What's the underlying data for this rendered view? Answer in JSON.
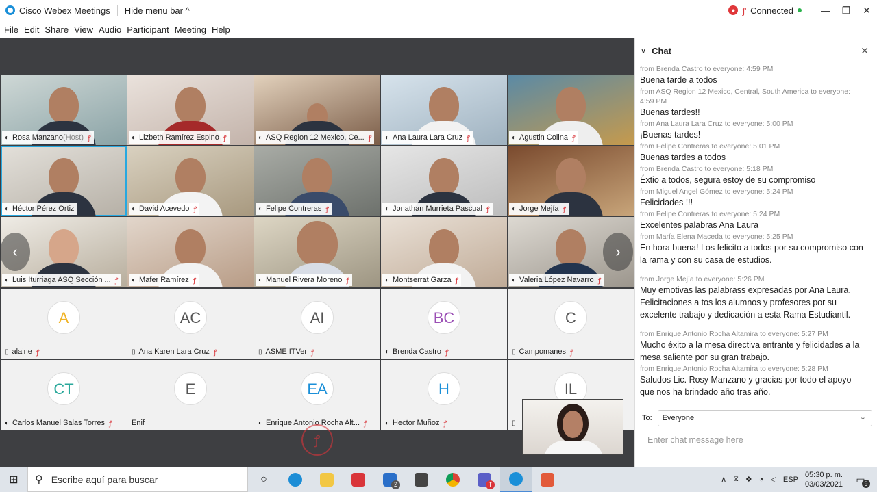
{
  "window": {
    "title": "Cisco Webex Meetings",
    "hide_menu": "Hide menu bar ^",
    "status": "Connected",
    "min": "—",
    "restore": "❐",
    "close": "✕"
  },
  "menu": [
    "File",
    "Edit",
    "Share",
    "View",
    "Audio",
    "Participant",
    "Meeting",
    "Help"
  ],
  "tiles": {
    "t1": {
      "name": "Rosa Manzano",
      "suffix": " (Host)"
    },
    "t2": {
      "name": "Lizbeth Ramírez Espino"
    },
    "t3": {
      "name": "ASQ Region 12 Mexico, Ce..."
    },
    "t4": {
      "name": "Ana Laura Lara Cruz"
    },
    "t5": {
      "name": "Agustin Colina"
    },
    "t6": {
      "name": "Héctor Pérez Ortiz"
    },
    "t7": {
      "name": "David Acevedo"
    },
    "t8": {
      "name": "Felipe Contreras"
    },
    "t9": {
      "name": "Jonathan Murrieta Pascual"
    },
    "t10": {
      "name": "Jorge Mejía"
    },
    "t11": {
      "name": "Luis Iturriaga ASQ Sección ..."
    },
    "t12": {
      "name": "Mafer Ramírez"
    },
    "t13": {
      "name": "Manuel Rivera Moreno"
    },
    "t14": {
      "name": "Montserrat Garza"
    },
    "t15": {
      "name": "Valeria López Navarro"
    },
    "a1": {
      "initials": "A",
      "name": "alaine"
    },
    "a2": {
      "initials": "AC",
      "name": "Ana Karen Lara Cruz"
    },
    "a3": {
      "initials": "AI",
      "name": "ASME ITVer"
    },
    "a4": {
      "initials": "BC",
      "name": "Brenda Castro"
    },
    "a5": {
      "initials": "C",
      "name": "Campomanes"
    },
    "a6": {
      "initials": "CT",
      "name": "Carlos Manuel Salas Torres"
    },
    "a7": {
      "initials": "E",
      "name": "Enif"
    },
    "a8": {
      "initials": "EA",
      "name": "Enrique Antonio Rocha Alt..."
    },
    "a9": {
      "initials": "H",
      "name": "Hector Muñoz"
    },
    "a10": {
      "initials": "IL",
      "name": ""
    }
  },
  "chat": {
    "title": "Chat",
    "messages": [
      {
        "meta": "from Brenda Castro to everyone:    4:59 PM",
        "text": "Buena tarde a todos"
      },
      {
        "meta": "from ASQ Region 12 Mexico, Central, South America to everyone: 4:59 PM",
        "text": "Buenas tardes!!"
      },
      {
        "meta": "from Ana Laura Lara Cruz to everyone:    5:00 PM",
        "text": "¡Buenas tardes!"
      },
      {
        "meta": "from Felipe Contreras to everyone:    5:01 PM",
        "text": "Buenas tardes a todos"
      },
      {
        "meta": "from Brenda Castro to everyone:    5:18 PM",
        "text": "Éxtio a todos, segura estoy de su compromiso"
      },
      {
        "meta": "from Miguel Angel Gómez to everyone:    5:24 PM",
        "text": "Felicidades !!!"
      },
      {
        "meta": "from Felipe Contreras to everyone:    5:24 PM",
        "text": "Excelentes palabras Ana Laura"
      },
      {
        "meta": "from María Elena Maceda to everyone:    5:25 PM",
        "text": "En hora buena! Los felicito a todos por su compromiso con la rama y con su casa de estudios."
      },
      {
        "meta": "from Jorge Mejía to everyone:    5:26 PM",
        "text": "Muy emotivas las palabrass expresadas por Ana Laura. Felicitaciones a tos los alumnos y profesores por su excelente trabajo y dedicación a esta Rama Estudiantil."
      },
      {
        "meta": "from Enrique Antonio Rocha Altamira to everyone:    5:27 PM",
        "text": "Mucho éxito a la mesa directiva entrante y felicidades a la mesa saliente por su gran trabajo."
      },
      {
        "meta": "from Enrique Antonio Rocha Altamira to everyone:    5:28 PM",
        "text": "Saludos Lic. Rosy Manzano y gracias por todo el apoyo que nos ha brindado año tras año."
      }
    ],
    "to_label": "To:",
    "to_value": "Everyone",
    "input_placeholder": "Enter chat message here"
  },
  "taskbar": {
    "search_placeholder": "Escribe aquí para buscar",
    "mail_badge": "2",
    "teams_badge": "T",
    "lang": "ESP",
    "time": "05:30 p. m.",
    "date": "03/03/2021",
    "notif_count": "9"
  }
}
